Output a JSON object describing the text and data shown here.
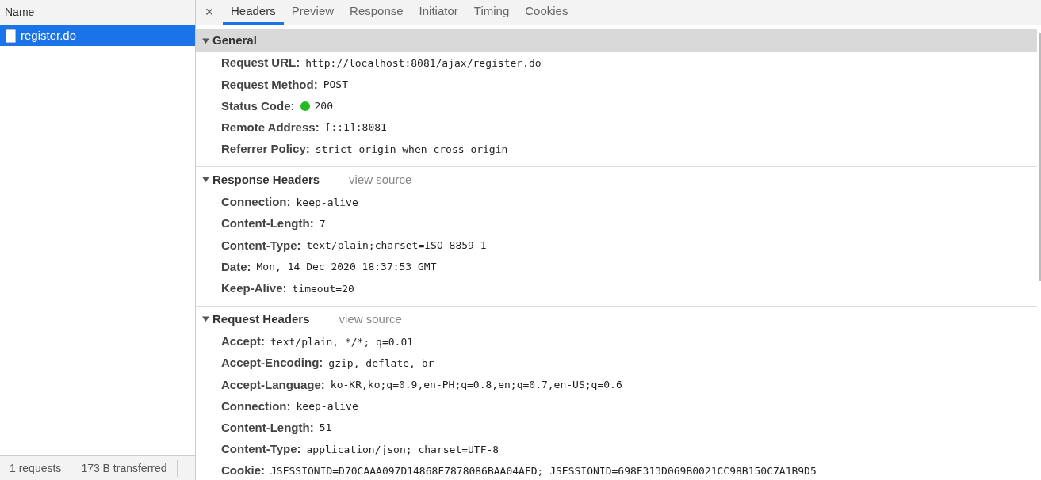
{
  "request_list": {
    "column_header": "Name",
    "items": [
      {
        "name": "register.do",
        "selected": true
      }
    ]
  },
  "status_bar": [
    "1 requests",
    "173 B transferred"
  ],
  "tabs": [
    {
      "label": "Headers",
      "selected": true
    },
    {
      "label": "Preview",
      "selected": false
    },
    {
      "label": "Response",
      "selected": false
    },
    {
      "label": "Initiator",
      "selected": false
    },
    {
      "label": "Timing",
      "selected": false
    },
    {
      "label": "Cookies",
      "selected": false
    }
  ],
  "close_label": "×",
  "sections": [
    {
      "title": "General",
      "expanded": true,
      "highlighted": true,
      "rows": [
        {
          "key": "Request URL:",
          "value": "http://localhost:8081/ajax/register.do"
        },
        {
          "key": "Request Method:",
          "value": "POST"
        },
        {
          "key": "Status Code:",
          "value": "200",
          "success": true
        },
        {
          "key": "Remote Address:",
          "value": "[::1]:8081"
        },
        {
          "key": "Referrer Policy:",
          "value": "strict-origin-when-cross-origin"
        }
      ]
    },
    {
      "title": "Response Headers",
      "expanded": true,
      "highlighted": false,
      "link": "view source",
      "rows": [
        {
          "key": "Connection:",
          "value": "keep-alive"
        },
        {
          "key": "Content-Length:",
          "value": "7"
        },
        {
          "key": "Content-Type:",
          "value": "text/plain;charset=ISO-8859-1"
        },
        {
          "key": "Date:",
          "value": "Mon, 14 Dec 2020 18:37:53 GMT"
        },
        {
          "key": "Keep-Alive:",
          "value": "timeout=20"
        }
      ]
    },
    {
      "title": "Request Headers",
      "expanded": true,
      "highlighted": false,
      "link": "view source",
      "rows": [
        {
          "key": "Accept:",
          "value": "text/plain, */*; q=0.01"
        },
        {
          "key": "Accept-Encoding:",
          "value": "gzip, deflate, br"
        },
        {
          "key": "Accept-Language:",
          "value": "ko-KR,ko;q=0.9,en-PH;q=0.8,en;q=0.7,en-US;q=0.6"
        },
        {
          "key": "Connection:",
          "value": "keep-alive"
        },
        {
          "key": "Content-Length:",
          "value": "51"
        },
        {
          "key": "Content-Type:",
          "value": "application/json; charset=UTF-8"
        },
        {
          "key": "Cookie:",
          "value": "JSESSIONID=D70CAAA097D14868F7878086BAA04AFD; JSESSIONID=698F313D069B0021CC98B150C7A1B9D5"
        }
      ]
    }
  ]
}
